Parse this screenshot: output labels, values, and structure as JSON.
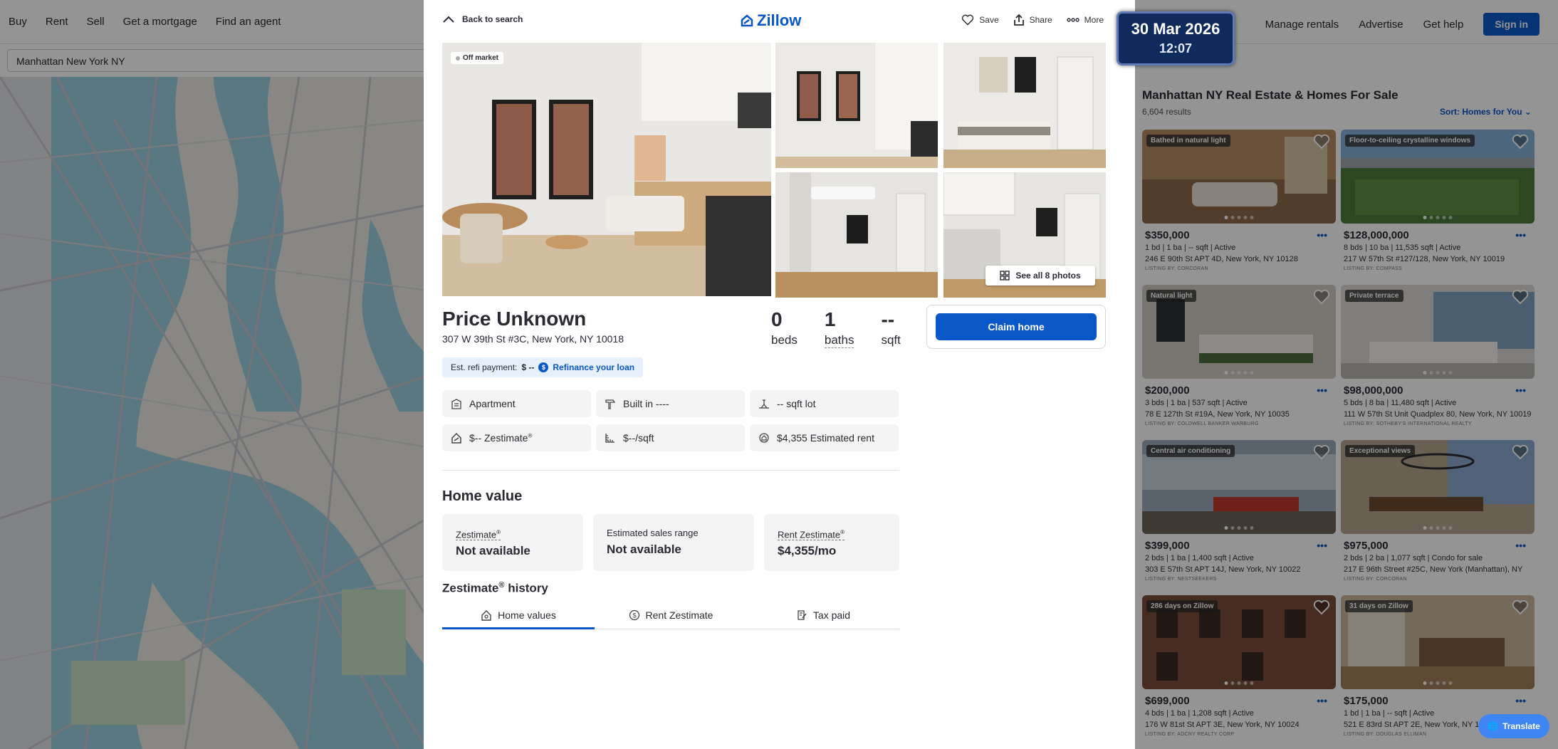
{
  "nav": {
    "left": [
      "Buy",
      "Rent",
      "Sell",
      "Get a mortgage",
      "Find an agent"
    ],
    "right": [
      "Manage rentals",
      "Advertise",
      "Get help"
    ],
    "signin": "Sign in"
  },
  "search": {
    "value": "Manhattan New York NY"
  },
  "clock": {
    "date": "30 Mar 2026",
    "time": "12:07"
  },
  "listings": {
    "title": "Manhattan NY Real Estate & Homes For Sale",
    "count": "6,604 results",
    "sort": "Sort: Homes for You",
    "cards": [
      {
        "tag": "Bathed in natural light",
        "price": "$350,000",
        "meta": "1 bd | 1 ba | -- sqft | Active",
        "addr": "246 E 90th St APT 4D, New York, NY 10128",
        "broker": "LISTING BY: CORCORAN"
      },
      {
        "tag": "Floor-to-ceiling crystalline windows",
        "price": "$128,000,000",
        "meta": "8 bds | 10 ba | 11,535 sqft | Active",
        "addr": "217 W 57th St #127/128, New York, NY 10019",
        "broker": "LISTING BY: COMPASS"
      },
      {
        "tag": "Natural light",
        "price": "$200,000",
        "meta": "3 bds | 1 ba | 537 sqft | Active",
        "addr": "78 E 127th St #19A, New York, NY 10035",
        "broker": "LISTING BY: COLDWELL BANKER WARBURG"
      },
      {
        "tag": "Private terrace",
        "price": "$98,000,000",
        "meta": "5 bds | 8 ba | 11,480 sqft | Active",
        "addr": "111 W 57th St Unit Quadplex 80, New York, NY 10019",
        "broker": "LISTING BY: SOTHEBY'S INTERNATIONAL REALTY"
      },
      {
        "tag": "Central air conditioning",
        "price": "$399,000",
        "meta": "2 bds | 1 ba | 1,400 sqft | Active",
        "addr": "303 E 57th St APT 14J, New York, NY 10022",
        "broker": "LISTING BY: NESTSEEKERS"
      },
      {
        "tag": "Exceptional views",
        "price": "$975,000",
        "meta": "2 bds | 2 ba | 1,077 sqft | Condo for sale",
        "addr": "217 E 96th Street #25C, New York (Manhattan), NY",
        "broker": "LISTING BY: CORCORAN"
      },
      {
        "tag": "286 days on Zillow",
        "price": "$699,000",
        "meta": "4 bds | 1 ba | 1,208 sqft | Active",
        "addr": "176 W 81st St APT 3E, New York, NY 10024",
        "broker": "LISTING BY: ADCNY REALTY CORP"
      },
      {
        "tag": "31 days on Zillow",
        "price": "$175,000",
        "meta": "1 bd | 1 ba | -- sqft | Active",
        "addr": "521 E 83rd St APT 2E, New York, NY 10028",
        "broker": "LISTING BY: DOUGLAS ELLIMAN"
      }
    ]
  },
  "translate": "Translate",
  "modal": {
    "back": "Back to search",
    "logo": "Zillow",
    "actions": {
      "save": "Save",
      "share": "Share",
      "more": "More"
    },
    "offmarket": "Off market",
    "see_all": "See all 8 photos",
    "price": "Price Unknown",
    "address": "307 W 39th St #3C, New York, NY 10018",
    "stats": [
      {
        "value": "0",
        "label": "beds"
      },
      {
        "value": "1",
        "label": "baths"
      },
      {
        "value": "--",
        "label": "sqft"
      }
    ],
    "claim": "Claim home",
    "refi": {
      "label": "Est. refi payment:",
      "value": "$ --",
      "link": "Refinance your loan"
    },
    "facts": {
      "type": "Apartment",
      "built": "Built in ----",
      "lot": "-- sqft lot",
      "zestimate": "$-- Zestimate",
      "ppsf": "$--/sqft",
      "rent": "$4,355 Estimated rent"
    },
    "home_value": {
      "title": "Home value",
      "zestimate_label": "Zestimate",
      "zestimate_value": "Not available",
      "range_label": "Estimated sales range",
      "range_value": "Not available",
      "rent_label": "Rent Zestimate",
      "rent_value": "$4,355/mo"
    },
    "history": {
      "title_a": "Zestimate",
      "title_b": " history",
      "tabs": [
        "Home values",
        "Rent Zestimate",
        "Tax paid"
      ]
    }
  }
}
